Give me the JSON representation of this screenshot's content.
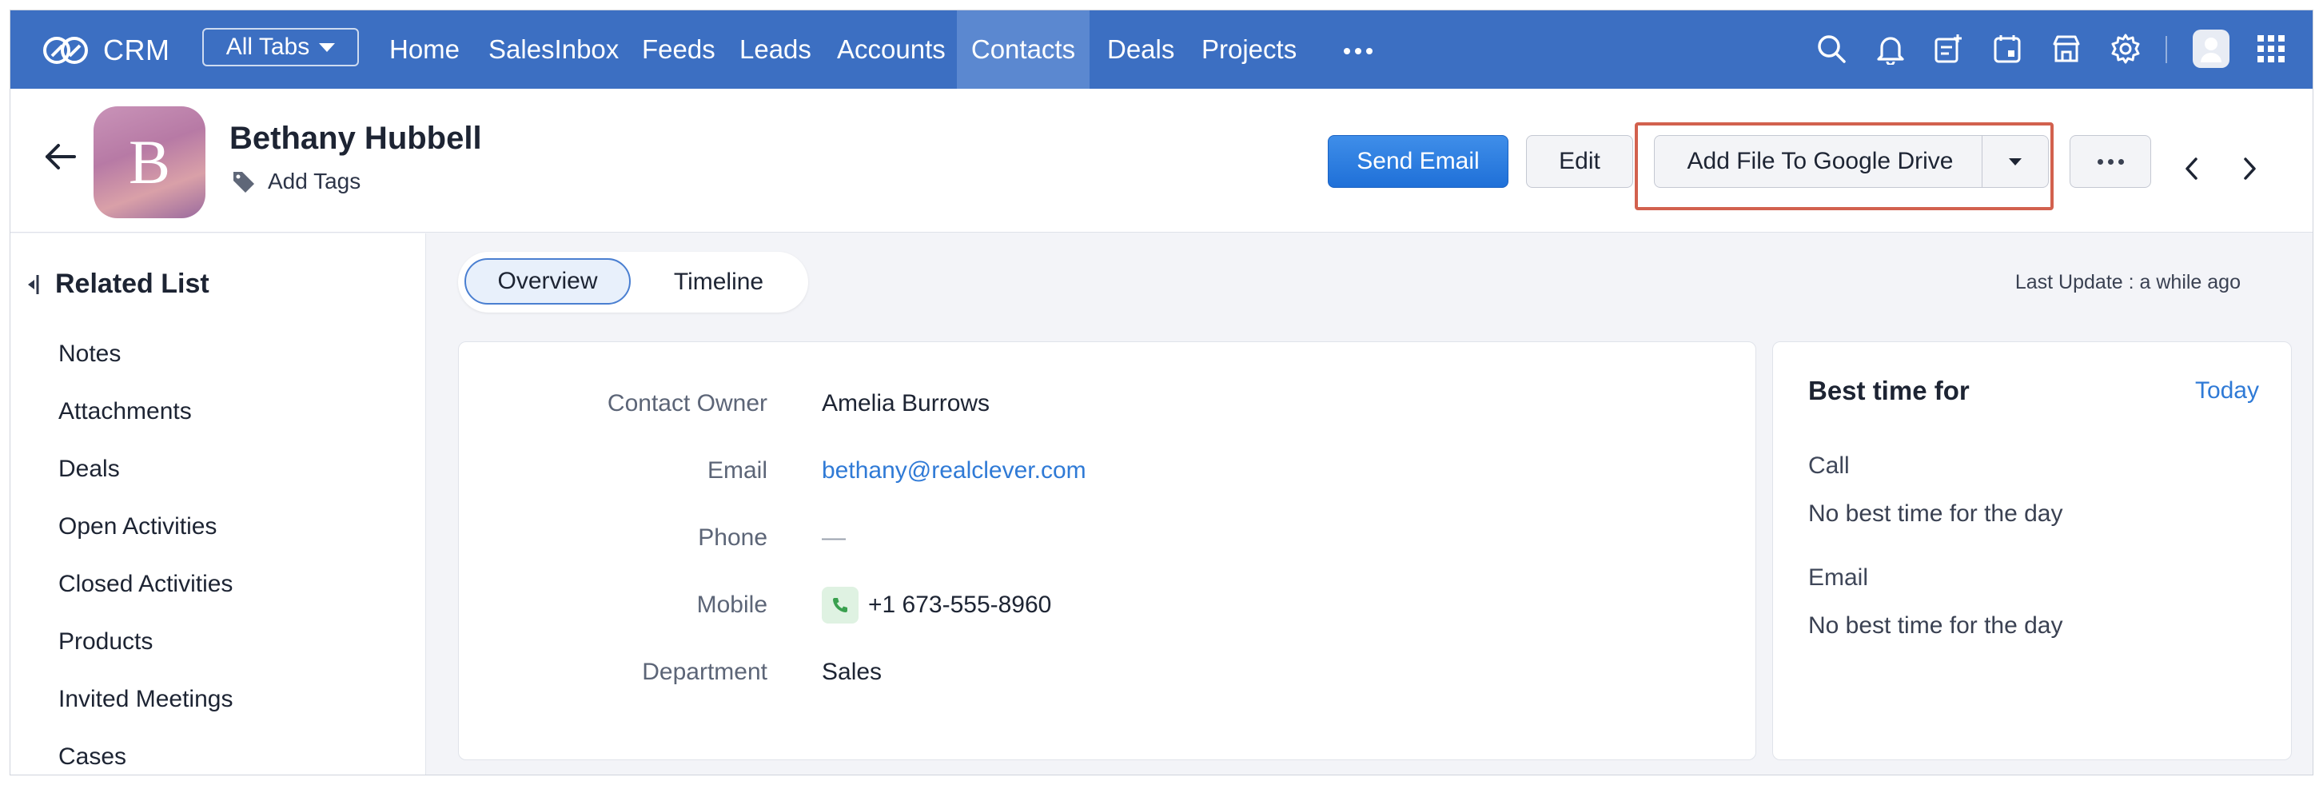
{
  "topnav": {
    "brand": "CRM",
    "all_tabs": "All Tabs",
    "tabs": [
      {
        "label": "Home"
      },
      {
        "label": "SalesInbox"
      },
      {
        "label": "Feeds"
      },
      {
        "label": "Leads"
      },
      {
        "label": "Accounts"
      },
      {
        "label": "Contacts",
        "active": true
      },
      {
        "label": "Deals"
      },
      {
        "label": "Projects"
      }
    ],
    "icons": [
      "search-icon",
      "bell-icon",
      "add-note-icon",
      "calendar-icon",
      "marketplace-icon",
      "gear-icon",
      "user-avatar",
      "apps-grid-icon"
    ]
  },
  "record": {
    "avatar_letter": "B",
    "name": "Bethany Hubbell",
    "add_tags": "Add Tags",
    "actions": {
      "send_email": "Send Email",
      "edit": "Edit",
      "add_file": "Add File To Google Drive"
    }
  },
  "sidebar": {
    "title": "Related List",
    "items": [
      {
        "label": "Notes"
      },
      {
        "label": "Attachments"
      },
      {
        "label": "Deals"
      },
      {
        "label": "Open Activities"
      },
      {
        "label": "Closed Activities"
      },
      {
        "label": "Products"
      },
      {
        "label": "Invited Meetings"
      },
      {
        "label": "Cases"
      }
    ]
  },
  "view_tabs": {
    "overview": "Overview",
    "timeline": "Timeline",
    "last_update": "Last Update : a while ago"
  },
  "details": {
    "contact_owner_label": "Contact Owner",
    "contact_owner": "Amelia Burrows",
    "email_label": "Email",
    "email": "bethany@realclever.com",
    "phone_label": "Phone",
    "phone": "—",
    "mobile_label": "Mobile",
    "mobile": "+1 673-555-8960",
    "department_label": "Department",
    "department": "Sales"
  },
  "best_time": {
    "title": "Best time for",
    "today": "Today",
    "call_label": "Call",
    "call_value": "No best time for the day",
    "email_label": "Email",
    "email_value": "No best time for the day"
  },
  "colors": {
    "nav_bg": "#3c6fc2",
    "nav_active": "#5b88d0",
    "primary": "#1f70d8",
    "link": "#2f7ad6",
    "highlight": "#d2614e"
  }
}
